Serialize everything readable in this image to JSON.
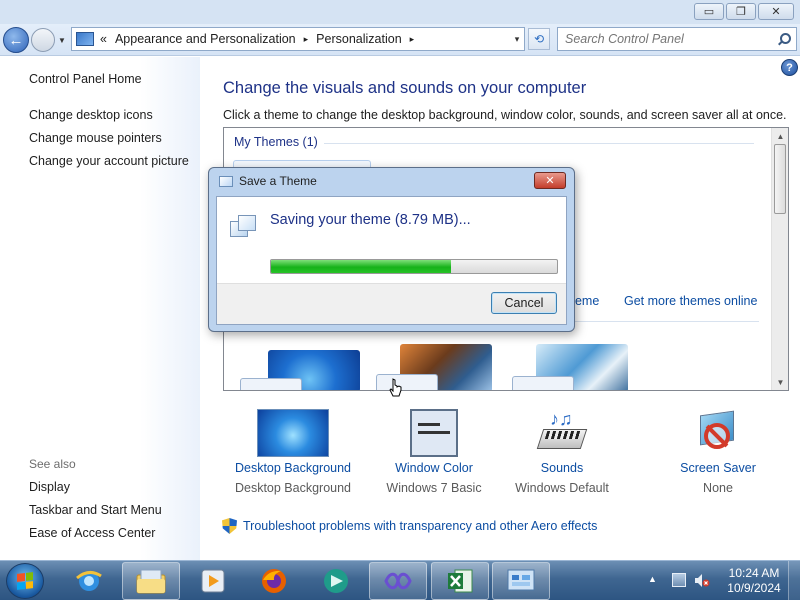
{
  "window": {
    "minimize_glyph": "▭",
    "maximize_glyph": "❐",
    "close_glyph": "✕"
  },
  "navbar": {
    "back_glyph": "←",
    "breadcrumb_lead": "«",
    "breadcrumbs": [
      "Appearance and Personalization",
      "Personalization"
    ],
    "crumb_separator": "▸",
    "address_dropdown": "▾",
    "refresh_glyph": "⟲",
    "search_placeholder": "Search Control Panel"
  },
  "sidebar": {
    "home": "Control Panel Home",
    "tasks": [
      "Change desktop icons",
      "Change mouse pointers",
      "Change your account picture"
    ],
    "see_also_label": "See also",
    "see_also": [
      "Display",
      "Taskbar and Start Menu",
      "Ease of Access Center"
    ]
  },
  "main": {
    "help_glyph": "?",
    "title": "Change the visuals and sounds on your computer",
    "description": "Click a theme to change the desktop background, window color, sounds, and screen saver all at once.",
    "my_themes": "My Themes (1)",
    "save_theme_link": "heme",
    "get_more_themes_link": "Get more themes online",
    "troubleshoot_link": "Troubleshoot problems with transparency and other Aero effects"
  },
  "tiles": [
    {
      "name": "Desktop Background",
      "sub": "Desktop Background",
      "icon": "desktop-background-icon"
    },
    {
      "name": "Window Color",
      "sub": "Windows 7 Basic",
      "icon": "window-color-icon"
    },
    {
      "name": "Sounds",
      "sub": "Windows Default",
      "icon": "sounds-icon"
    },
    {
      "name": "Screen Saver",
      "sub": "None",
      "icon": "screen-saver-icon"
    }
  ],
  "dialog": {
    "title": "Save a Theme",
    "close_glyph": "✕",
    "message": "Saving your theme (8.79 MB)...",
    "progress": 0.63,
    "cancel_label": "Cancel"
  },
  "taskbar": {
    "items": [
      "internet-explorer-icon",
      "file-explorer-icon",
      "media-player-icon",
      "firefox-icon",
      "app-icon",
      "visual-studio-icon",
      "excel-icon",
      "control-panel-icon"
    ],
    "active_item": "control-panel-icon",
    "tray_arrow": "▲",
    "time": "10:24 AM",
    "date": "10/9/2024"
  },
  "colors": {
    "link": "#0c4da2",
    "heading": "#1e3287",
    "progress": "#17b21a",
    "taskbar": "#3f6691"
  }
}
